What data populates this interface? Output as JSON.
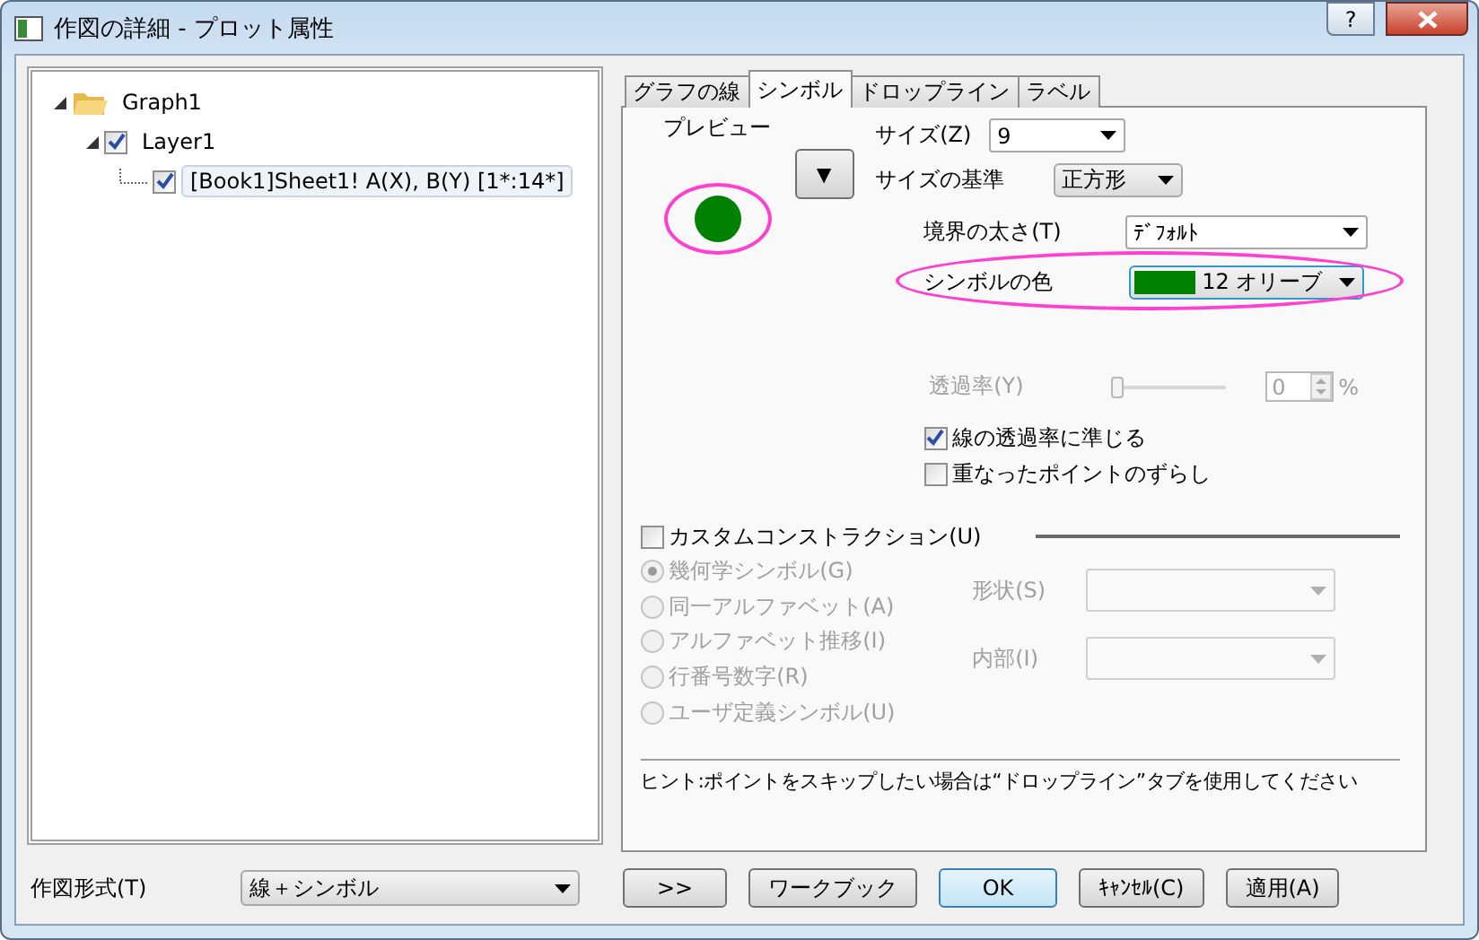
{
  "window": {
    "title": "作図の詳細 - プロット属性",
    "help": "?"
  },
  "tree": [
    {
      "label": "Graph1",
      "kind": "folder",
      "expanded": true,
      "children": [
        {
          "label": "Layer1",
          "kind": "checkbox",
          "checked": true,
          "expanded": true,
          "children": [
            {
              "label": "[Book1]Sheet1!  A(X), B(Y)  [1*:14*]",
              "kind": "checkbox",
              "checked": true,
              "selected": true
            }
          ]
        }
      ]
    }
  ],
  "tabs": [
    {
      "label": "グラフの線",
      "selected": false
    },
    {
      "label": "シンボル",
      "selected": true
    },
    {
      "label": "ドロップライン",
      "selected": false
    },
    {
      "label": "ラベル",
      "selected": false
    }
  ],
  "symbol_tab": {
    "preview_label": "プレビュー",
    "menu_arrow": "▼",
    "size": {
      "label": "サイズ(Z)",
      "value": "9"
    },
    "size_basis": {
      "label": "サイズの基準",
      "value": "正方形"
    },
    "edge_width": {
      "label": "境界の太さ(T)",
      "value": "ﾃﾞﾌｫﾙﾄ"
    },
    "symbol_color": {
      "label": "シンボルの色",
      "value": "12 オリーブ"
    },
    "transparency": {
      "label": "透過率(Y)",
      "value": "0",
      "unit": "%",
      "level": 0,
      "disabled": true
    },
    "checkboxes": [
      {
        "label": "線の透過率に準じる",
        "checked": true
      },
      {
        "label": "重なったポイントのずらし",
        "checked": false
      }
    ],
    "custom": {
      "label": "カスタムコンストラクション(U)",
      "checked": false
    },
    "radios": [
      {
        "label": "幾何学シンボル(G)",
        "selected": true,
        "disabled": true
      },
      {
        "label": "同一アルファベット(A)",
        "selected": false,
        "disabled": true
      },
      {
        "label": "アルファベット推移(I)",
        "selected": false,
        "disabled": true
      },
      {
        "label": "行番号数字(R)",
        "selected": false,
        "disabled": true
      },
      {
        "label": "ユーザ定義シンボル(U)",
        "selected": false,
        "disabled": true
      }
    ],
    "shape": {
      "label": "形状(S)",
      "disabled": true
    },
    "interior": {
      "label": "内部(I)",
      "disabled": true
    },
    "hint": "ヒント:ポイントをスキップしたい場合は“ドロップライン”タブを使用してください"
  },
  "plot_type": {
    "label": "作図形式(T)",
    "value": "線＋シンボル"
  },
  "buttons": [
    {
      "label": ">>",
      "default": false
    },
    {
      "label": "ワークブック",
      "default": false
    },
    {
      "label": "OK",
      "default": true
    },
    {
      "label": "ｷｬﾝｾﾙ(C)",
      "default": false
    },
    {
      "label": "適用(A)",
      "default": false
    }
  ]
}
